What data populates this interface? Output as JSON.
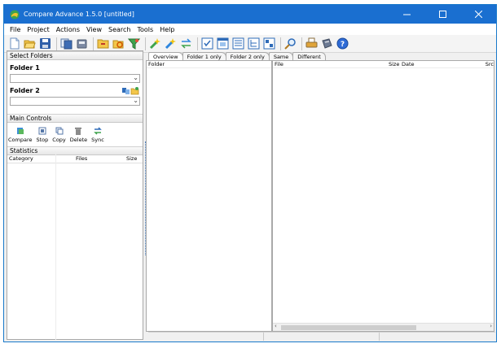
{
  "window": {
    "title": "Compare Advance 1.5.0 [untitled]"
  },
  "titlebar_controls": [
    "minimize-icon",
    "maximize-icon",
    "close-icon"
  ],
  "menu": [
    "File",
    "Project",
    "Actions",
    "View",
    "Search",
    "Tools",
    "Help"
  ],
  "toolbar_icons": [
    "new-project-icon",
    "open-project-icon",
    "save-project-icon",
    "copy-files-icon",
    "move-files-icon",
    "compare-icon",
    "refresh-icon",
    "filter-icon",
    "add-left-icon",
    "add-right-icon",
    "swap-icon",
    "view-grid-icon",
    "view-window-icon",
    "view-list-icon",
    "view-tree-icon",
    "view-detail-icon",
    "search-icon",
    "print-icon",
    "export-icon",
    "help-icon"
  ],
  "left": {
    "select_folders_header": "Select Folders",
    "folder1_label": "Folder 1",
    "folder1_value": "",
    "folder2_label": "Folder 2",
    "folder2_value": "",
    "main_controls_header": "Main Controls",
    "controls": [
      "Compare",
      "Stop",
      "Copy",
      "Delete",
      "Sync"
    ],
    "statistics_header": "Statistics",
    "stats_columns": [
      "Category",
      "Files",
      "Size"
    ]
  },
  "tabs": [
    "Overview",
    "Folder 1 only",
    "Folder 2 only",
    "Same",
    "Different"
  ],
  "active_tab": "Overview",
  "folder_pane": {
    "columns": [
      "Folder"
    ]
  },
  "file_pane": {
    "columns": [
      "File",
      "Size",
      "Date",
      "Src"
    ]
  },
  "colors": {
    "titlebar": "#1a6fd0",
    "window_bg": "#f0f0f0",
    "accent": "#1979ca"
  }
}
